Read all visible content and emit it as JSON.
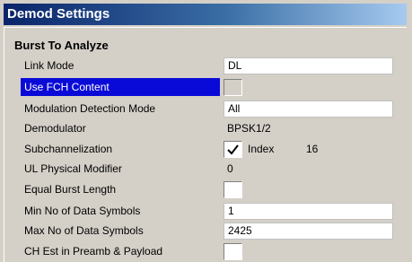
{
  "window": {
    "title": "Demod Settings"
  },
  "section": {
    "title": "Burst To Analyze"
  },
  "rows": {
    "link_mode": {
      "label": "Link Mode",
      "value": "DL"
    },
    "use_fch": {
      "label": "Use FCH Content",
      "checked": false
    },
    "mod_detection": {
      "label": "Modulation Detection Mode",
      "value": "All"
    },
    "demodulator": {
      "label": "Demodulator",
      "value": "BPSK1/2"
    },
    "subchannelization": {
      "label": "Subchannelization",
      "checked": true,
      "index_label": "Index",
      "index_value": "16"
    },
    "ul_phys_modifier": {
      "label": "UL Physical Modifier",
      "value": "0"
    },
    "equal_burst": {
      "label": "Equal Burst Length",
      "checked": false
    },
    "min_symbols": {
      "label": "Min No of Data Symbols",
      "value": "1"
    },
    "max_symbols": {
      "label": "Max No of Data Symbols",
      "value": "2425"
    },
    "ch_est": {
      "label": "CH Est in Preamb & Payload",
      "checked": false
    }
  }
}
